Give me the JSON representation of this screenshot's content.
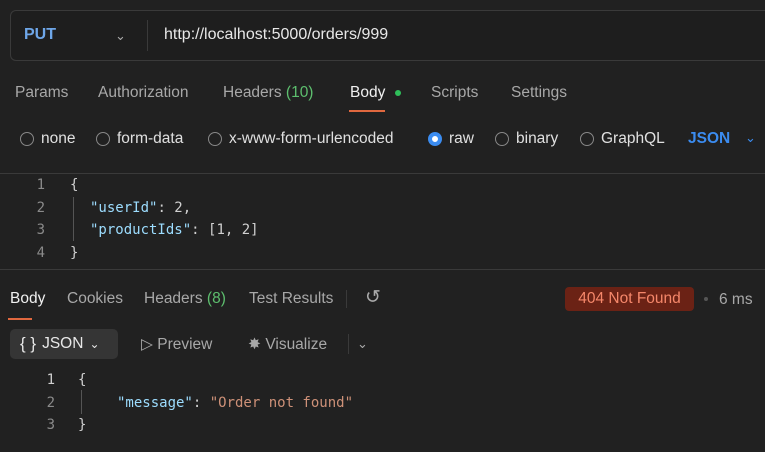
{
  "request": {
    "method": "PUT",
    "url": "http://localhost:5000/orders/999"
  },
  "tabs": [
    {
      "label": "Params"
    },
    {
      "label": "Authorization"
    },
    {
      "label": "Headers",
      "count": "(10)"
    },
    {
      "label": "Body"
    },
    {
      "label": "Scripts"
    },
    {
      "label": "Settings"
    }
  ],
  "body_types": [
    {
      "label": "none",
      "selected": false
    },
    {
      "label": "form-data",
      "selected": false
    },
    {
      "label": "x-www-form-urlencoded",
      "selected": false
    },
    {
      "label": "raw",
      "selected": true
    },
    {
      "label": "binary",
      "selected": false
    },
    {
      "label": "GraphQL",
      "selected": false
    }
  ],
  "format": "JSON",
  "request_body": {
    "lines": [
      "1",
      "2",
      "3",
      "4"
    ],
    "open": "{",
    "k1": "\"userId\"",
    "v1": "2,",
    "k2": "\"productIds\"",
    "v2": "[1, 2]",
    "close": "}"
  },
  "response_tabs": [
    {
      "label": "Body"
    },
    {
      "label": "Cookies"
    },
    {
      "label": "Headers",
      "count": "(8)"
    },
    {
      "label": "Test Results"
    }
  ],
  "status": {
    "text": "404 Not Found",
    "time": "6 ms",
    "color": "#f5876a"
  },
  "response_view": {
    "format": "JSON",
    "preview": "Preview",
    "visualize": "Visualize"
  },
  "response_body": {
    "lines": [
      "1",
      "2",
      "3"
    ],
    "open": "{",
    "key": "\"message\"",
    "value": "\"Order not found\"",
    "close": "}"
  }
}
